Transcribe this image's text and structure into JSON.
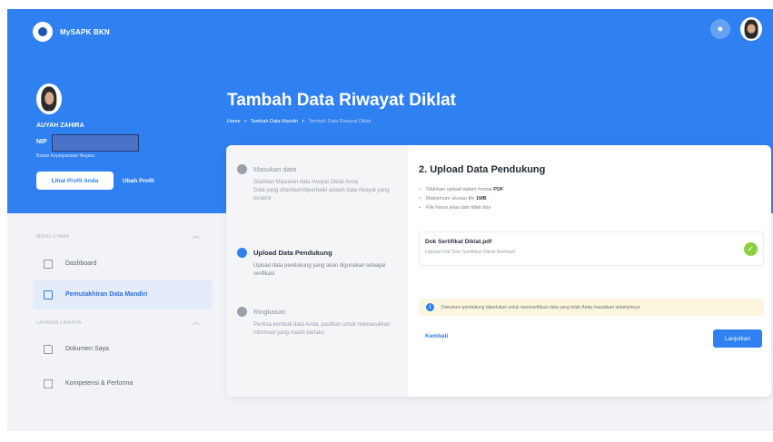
{
  "app": {
    "name": "MySAPK BKN"
  },
  "profile": {
    "name": "AUYAH ZAHIRA",
    "nip_label": "NIP",
    "org": "Badan Kepegawaian Negara",
    "view_profile": "Lihat Profil Anda",
    "edit_profile": "Ubah Profil"
  },
  "sidebar": {
    "section_main": "MENU UTAMA",
    "section_other": "LAYANAN LAINNYA",
    "items": [
      {
        "label": "Dashboard"
      },
      {
        "label": "Pemutakhiran Data Mandiri"
      },
      {
        "label": "Dokumen Saya"
      },
      {
        "label": "Kompetensi & Performa"
      }
    ]
  },
  "page": {
    "title": "Tambah Data Riwayat Diklat",
    "breadcrumb": [
      "Home",
      ">",
      "Tambah Data Mandiri",
      ">",
      "Tambah Data Riwayat Diklat"
    ]
  },
  "steps": [
    {
      "title": "Masukan data",
      "desc": "Silahkan Masukan data riwayat Diklat Anda\nData yang ditambah/diperbaiki adalah data riwayat yang terakhir"
    },
    {
      "title": "Upload Data Pendukung",
      "desc": "Upload data pendukung yang akan digunakan sebagai verifikasi"
    },
    {
      "title": "Ringkasan",
      "desc": "Periksa kembali data Anda, pastikan untuk memasukkan informasi yang masih berlaku"
    }
  ],
  "upload": {
    "title": "2. Upload Data Pendukung",
    "rules": [
      {
        "text": "Silahkan upload dalam format ",
        "strong": "PDF"
      },
      {
        "text": "Maksimum ukuran file ",
        "strong": "1MB"
      },
      {
        "text": "File harus jelas dan tidak blur",
        "strong": ""
      }
    ],
    "doc_name": "Dok Sertifikat Diklat.pdf",
    "doc_status": "Upload File Dok Sertifikat Diklat Berhasil",
    "info": "Dokumen pendukung diperlukan untuk memverifikasi data yang telah Anda masukkan sebelumnya",
    "back": "Kembali",
    "next": "Lanjutkan"
  },
  "colors": {
    "primary": "#2f80f0",
    "success": "#8ccf3f",
    "info_bg": "#fdf6de"
  }
}
